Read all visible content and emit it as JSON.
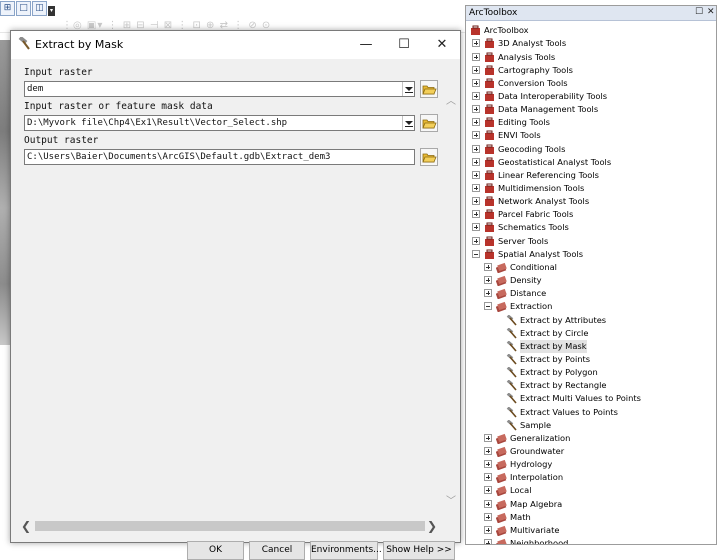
{
  "dialog": {
    "title": "Extract by Mask",
    "window_controls": [
      "minimize-icon",
      "maximize-icon",
      "close-icon"
    ],
    "fields": [
      {
        "label": "Input raster",
        "value": "dem",
        "type": "dropdown"
      },
      {
        "label": "Input raster or feature mask data",
        "value": "D:\\Myvork file\\Chp4\\Ex1\\Result\\Vector_Select.shp",
        "type": "dropdown"
      },
      {
        "label": "Output raster",
        "value": "C:\\Users\\Baier\\Documents\\ArcGIS\\Default.gdb\\Extract_dem3",
        "type": "text"
      }
    ],
    "buttons": {
      "ok": "OK",
      "cancel": "Cancel",
      "environments": "Environments...",
      "show_help": "Show Help >>"
    }
  },
  "toolbox": {
    "title": "ArcToolbox",
    "root": "ArcToolbox",
    "items": [
      {
        "label": "3D Analyst Tools",
        "depth": 1,
        "kind": "toolbox",
        "state": "collapsed"
      },
      {
        "label": "Analysis Tools",
        "depth": 1,
        "kind": "toolbox",
        "state": "collapsed"
      },
      {
        "label": "Cartography Tools",
        "depth": 1,
        "kind": "toolbox",
        "state": "collapsed"
      },
      {
        "label": "Conversion Tools",
        "depth": 1,
        "kind": "toolbox",
        "state": "collapsed"
      },
      {
        "label": "Data Interoperability Tools",
        "depth": 1,
        "kind": "toolbox",
        "state": "collapsed"
      },
      {
        "label": "Data Management Tools",
        "depth": 1,
        "kind": "toolbox",
        "state": "collapsed"
      },
      {
        "label": "Editing Tools",
        "depth": 1,
        "kind": "toolbox",
        "state": "collapsed"
      },
      {
        "label": "ENVI Tools",
        "depth": 1,
        "kind": "toolbox",
        "state": "collapsed"
      },
      {
        "label": "Geocoding Tools",
        "depth": 1,
        "kind": "toolbox",
        "state": "collapsed"
      },
      {
        "label": "Geostatistical Analyst Tools",
        "depth": 1,
        "kind": "toolbox",
        "state": "collapsed"
      },
      {
        "label": "Linear Referencing Tools",
        "depth": 1,
        "kind": "toolbox",
        "state": "collapsed"
      },
      {
        "label": "Multidimension Tools",
        "depth": 1,
        "kind": "toolbox",
        "state": "collapsed"
      },
      {
        "label": "Network Analyst Tools",
        "depth": 1,
        "kind": "toolbox",
        "state": "collapsed"
      },
      {
        "label": "Parcel Fabric Tools",
        "depth": 1,
        "kind": "toolbox",
        "state": "collapsed"
      },
      {
        "label": "Schematics Tools",
        "depth": 1,
        "kind": "toolbox",
        "state": "collapsed"
      },
      {
        "label": "Server Tools",
        "depth": 1,
        "kind": "toolbox",
        "state": "collapsed"
      },
      {
        "label": "Spatial Analyst Tools",
        "depth": 1,
        "kind": "toolbox",
        "state": "expanded"
      },
      {
        "label": "Conditional",
        "depth": 2,
        "kind": "toolset",
        "state": "collapsed"
      },
      {
        "label": "Density",
        "depth": 2,
        "kind": "toolset",
        "state": "collapsed"
      },
      {
        "label": "Distance",
        "depth": 2,
        "kind": "toolset",
        "state": "collapsed"
      },
      {
        "label": "Extraction",
        "depth": 2,
        "kind": "toolset",
        "state": "expanded"
      },
      {
        "label": "Extract by Attributes",
        "depth": 3,
        "kind": "tool"
      },
      {
        "label": "Extract by Circle",
        "depth": 3,
        "kind": "tool"
      },
      {
        "label": "Extract by Mask",
        "depth": 3,
        "kind": "tool",
        "selected": true
      },
      {
        "label": "Extract by Points",
        "depth": 3,
        "kind": "tool"
      },
      {
        "label": "Extract by Polygon",
        "depth": 3,
        "kind": "tool"
      },
      {
        "label": "Extract by Rectangle",
        "depth": 3,
        "kind": "tool"
      },
      {
        "label": "Extract Multi Values to Points",
        "depth": 3,
        "kind": "tool"
      },
      {
        "label": "Extract Values to Points",
        "depth": 3,
        "kind": "tool"
      },
      {
        "label": "Sample",
        "depth": 3,
        "kind": "tool"
      },
      {
        "label": "Generalization",
        "depth": 2,
        "kind": "toolset",
        "state": "collapsed"
      },
      {
        "label": "Groundwater",
        "depth": 2,
        "kind": "toolset",
        "state": "collapsed"
      },
      {
        "label": "Hydrology",
        "depth": 2,
        "kind": "toolset",
        "state": "collapsed"
      },
      {
        "label": "Interpolation",
        "depth": 2,
        "kind": "toolset",
        "state": "collapsed"
      },
      {
        "label": "Local",
        "depth": 2,
        "kind": "toolset",
        "state": "collapsed"
      },
      {
        "label": "Map Algebra",
        "depth": 2,
        "kind": "toolset",
        "state": "collapsed"
      },
      {
        "label": "Math",
        "depth": 2,
        "kind": "toolset",
        "state": "collapsed"
      },
      {
        "label": "Multivariate",
        "depth": 2,
        "kind": "toolset",
        "state": "collapsed"
      },
      {
        "label": "Neighborhood",
        "depth": 2,
        "kind": "toolset",
        "state": "collapsed"
      }
    ]
  },
  "colors": {
    "toolbox_red": "#b8332b",
    "toolset_red": "#a8473e",
    "folder_yellow": "#e8b934",
    "header_blue": "#dfe6f1"
  }
}
